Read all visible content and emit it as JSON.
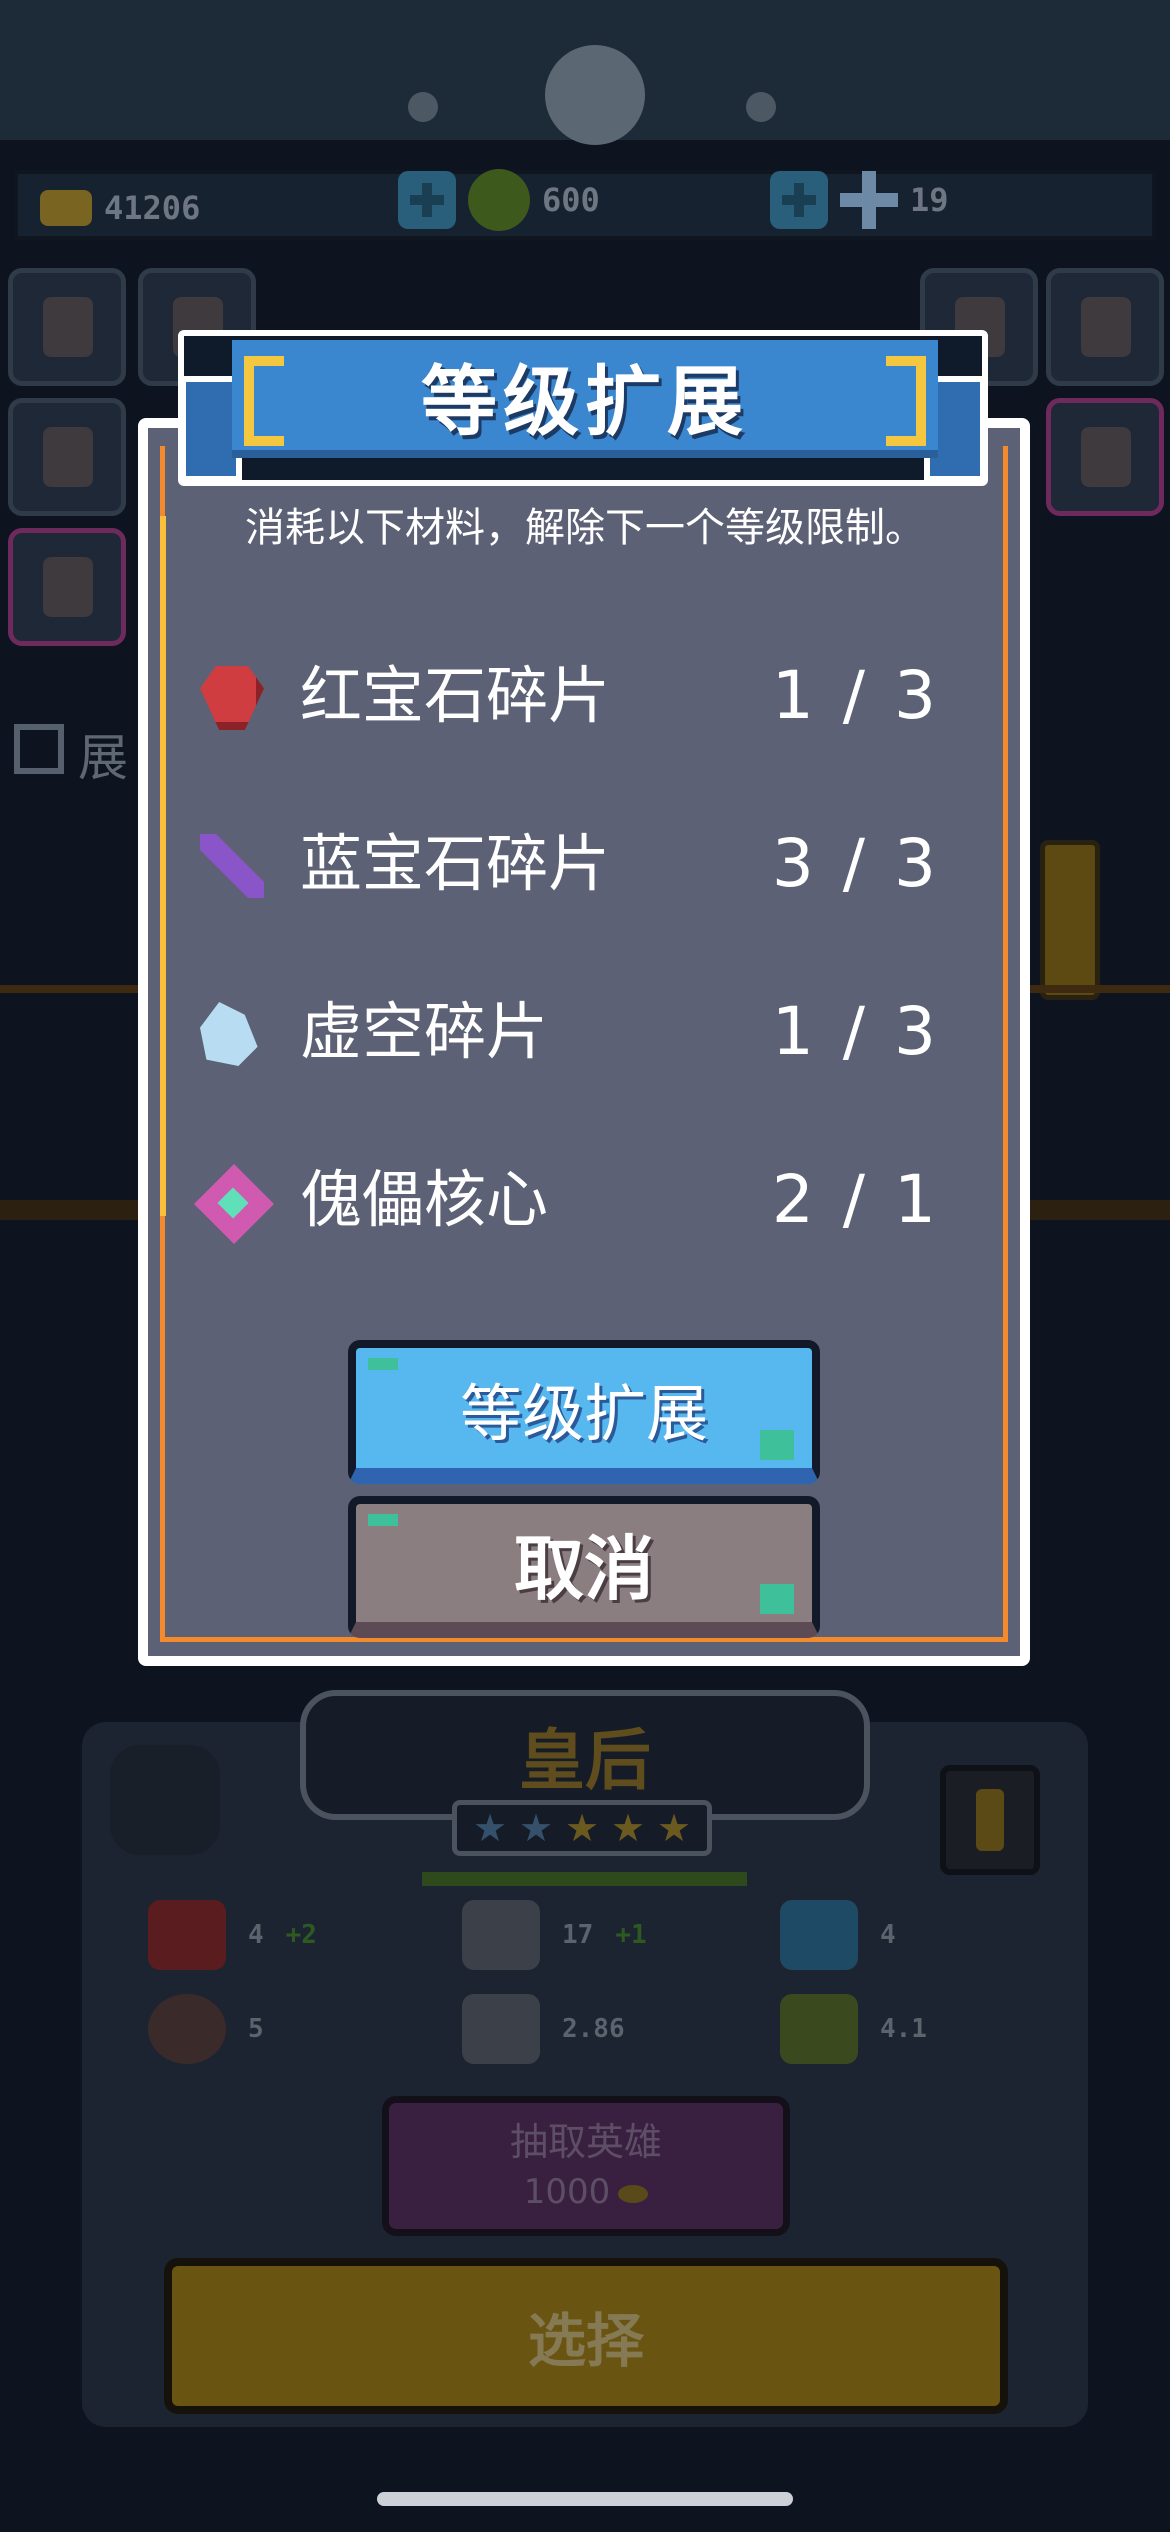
{
  "resources": {
    "coins": "41206",
    "gems": "600",
    "crystals": "19"
  },
  "background": {
    "checkbox_label": "展",
    "hero_name": "皇后",
    "stars": [
      "★",
      "★",
      "★",
      "★",
      "★"
    ],
    "stats": {
      "health": "4",
      "health_bonus": "+2",
      "attack": "17",
      "attack_bonus": "+1",
      "shield": "4",
      "armor": "5",
      "attack_speed": "2.86",
      "move_speed": "4.1"
    },
    "summon_button": {
      "label": "抽取英雄",
      "cost": "1000"
    },
    "select_button": "选择"
  },
  "modal": {
    "title": "等级扩展",
    "description": "消耗以下材料，解除下一个等级限制。",
    "materials": [
      {
        "name": "红宝石碎片",
        "count": "1 / 3",
        "icon": "ruby-shard-icon",
        "color": "#cf3d41"
      },
      {
        "name": "蓝宝石碎片",
        "count": "3 / 3",
        "icon": "sapphire-shard-icon",
        "color": "#8a55c8"
      },
      {
        "name": "虚空碎片",
        "count": "1 / 3",
        "icon": "void-shard-icon",
        "color": "#b8dcf2"
      },
      {
        "name": "傀儡核心",
        "count": "2 / 1",
        "icon": "golem-core-icon",
        "color": "#d05ab0"
      }
    ],
    "confirm_button": "等级扩展",
    "cancel_button": "取消"
  },
  "colors": {
    "modal_bg": "#5c6175",
    "title_blue": "#3a86cf",
    "accent_orange": "#f38a2c",
    "confirm_blue": "#56b8ee",
    "cancel_gray": "#8a7e80"
  }
}
